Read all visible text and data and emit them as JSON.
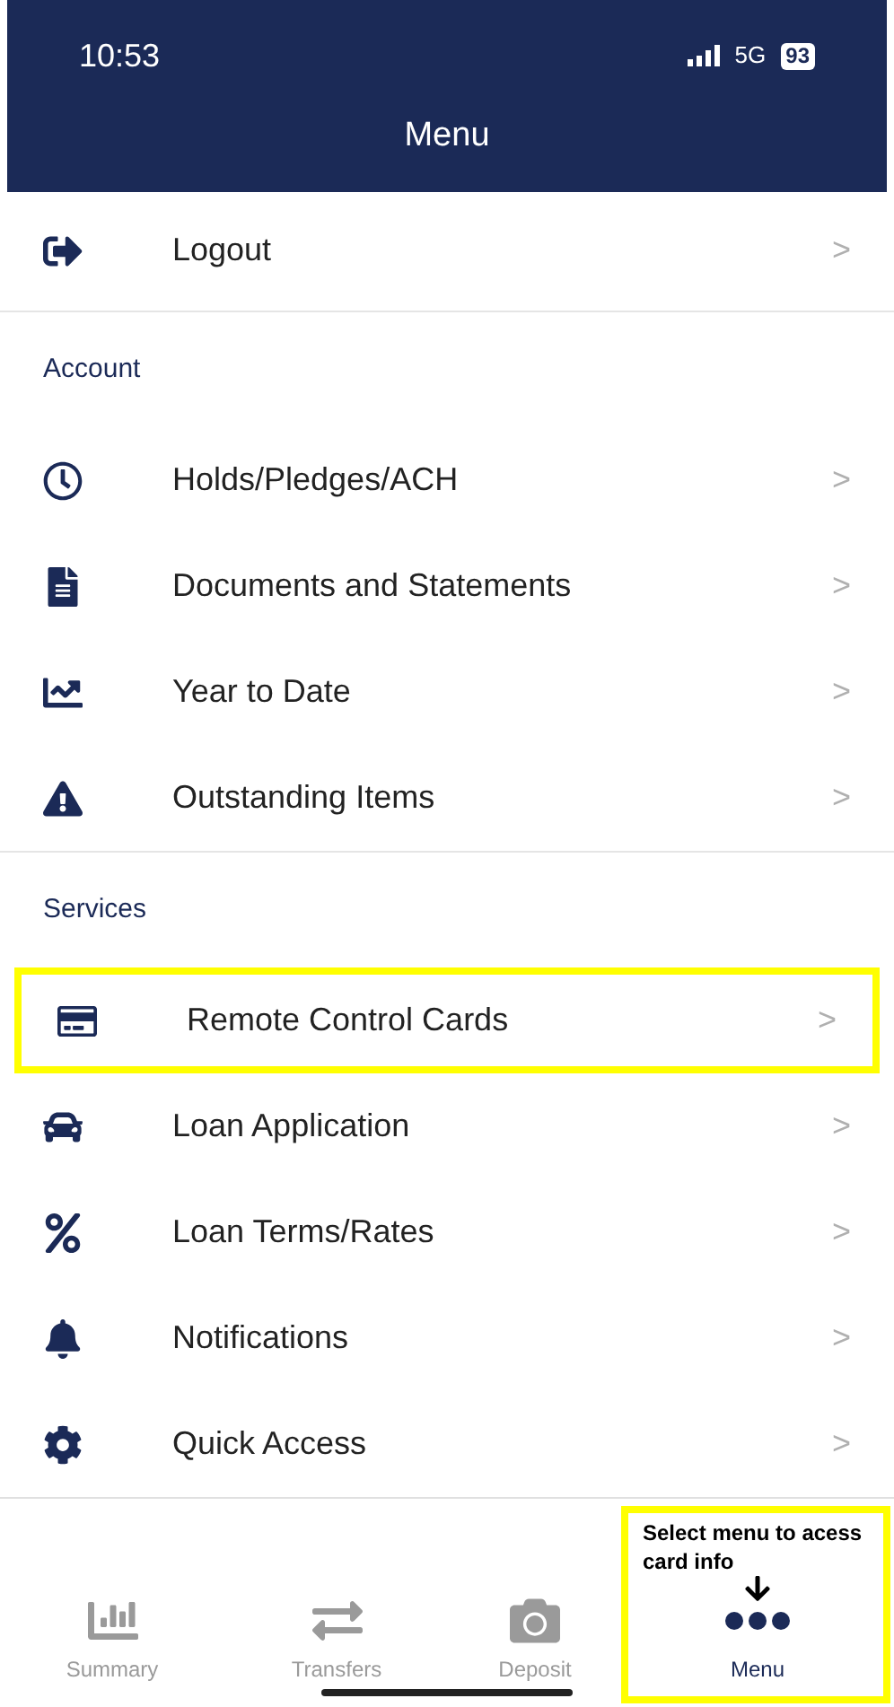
{
  "status_bar": {
    "time": "10:53",
    "network": "5G",
    "battery": "93"
  },
  "header": {
    "title": "Menu"
  },
  "logout": {
    "label": "Logout",
    "chevron": ">"
  },
  "sections": [
    {
      "title": "Account",
      "items": [
        {
          "label": "Holds/Pledges/ACH",
          "chevron": ">",
          "highlighted": false
        },
        {
          "label": "Documents and Statements",
          "chevron": ">",
          "highlighted": false
        },
        {
          "label": "Year to Date",
          "chevron": ">",
          "highlighted": false
        },
        {
          "label": "Outstanding Items",
          "chevron": ">",
          "highlighted": false
        }
      ]
    },
    {
      "title": "Services",
      "items": [
        {
          "label": "Remote Control Cards",
          "chevron": ">",
          "highlighted": true
        },
        {
          "label": "Loan Application",
          "chevron": ">",
          "highlighted": false
        },
        {
          "label": "Loan Terms/Rates",
          "chevron": ">",
          "highlighted": false
        },
        {
          "label": "Notifications",
          "chevron": ">",
          "highlighted": false
        },
        {
          "label": "Quick Access",
          "chevron": ">",
          "highlighted": false
        }
      ]
    }
  ],
  "tabs": [
    {
      "label": "Summary",
      "selected": false
    },
    {
      "label": "Transfers",
      "selected": false
    },
    {
      "label": "Deposit",
      "selected": false
    },
    {
      "label": "Menu",
      "selected": true
    }
  ],
  "annotation": {
    "text": "Select menu to acess card info"
  }
}
